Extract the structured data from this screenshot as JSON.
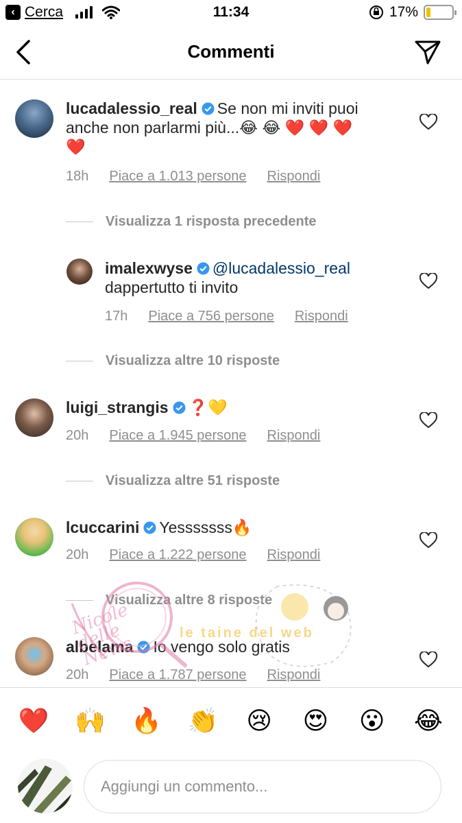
{
  "status_bar": {
    "back_app": "Cerca",
    "time": "11:34",
    "battery": "17%",
    "battery_level": 0.17
  },
  "nav": {
    "title": "Commenti"
  },
  "comments": [
    {
      "username": "lucadalessio_real",
      "text_line1": "Se non mi inviti puoi",
      "text_line2": "anche non parlarmi più...😂 😂 ❤️ ❤️ ❤️",
      "text_line3": "❤️",
      "time": "18h",
      "likes": "Piace a 1.013 persone",
      "reply": "Rispondi"
    },
    {
      "username": "imalexwyse",
      "mention": "@lucadalessio_real",
      "text_line2": "dappertutto ti invito",
      "time": "17h",
      "likes": "Piace a 756 persone",
      "reply": "Rispondi"
    },
    {
      "username": "luigi_strangis",
      "text": "❓💛",
      "time": "20h",
      "likes": "Piace a 1.945 persone",
      "reply": "Rispondi"
    },
    {
      "username": "lcuccarini",
      "text": "Yesssssss🔥",
      "time": "20h",
      "likes": "Piace a 1.222 persone",
      "reply": "Rispondi"
    },
    {
      "username": "albelama",
      "text": "Io vengo solo gratis",
      "time": "20h",
      "likes": "Piace a 1.787 persone",
      "reply": "Rispondi"
    }
  ],
  "view_more": [
    "Visualizza 1 risposta precedente",
    "Visualizza altre 10 risposte",
    "Visualizza altre 51 risposte",
    "Visualizza altre 8 risposte"
  ],
  "reactions": [
    "❤️",
    "🙌",
    "🔥",
    "👏",
    "😢",
    "😍",
    "😮",
    "😂"
  ],
  "input": {
    "placeholder": "Aggiungi un commento..."
  },
  "watermarks": {
    "left": "Nicole delle News",
    "right": "le taine del web"
  },
  "colors": {
    "verified": "#3897f0",
    "meta": "#8e8e8e",
    "battery": "#f2c200"
  }
}
